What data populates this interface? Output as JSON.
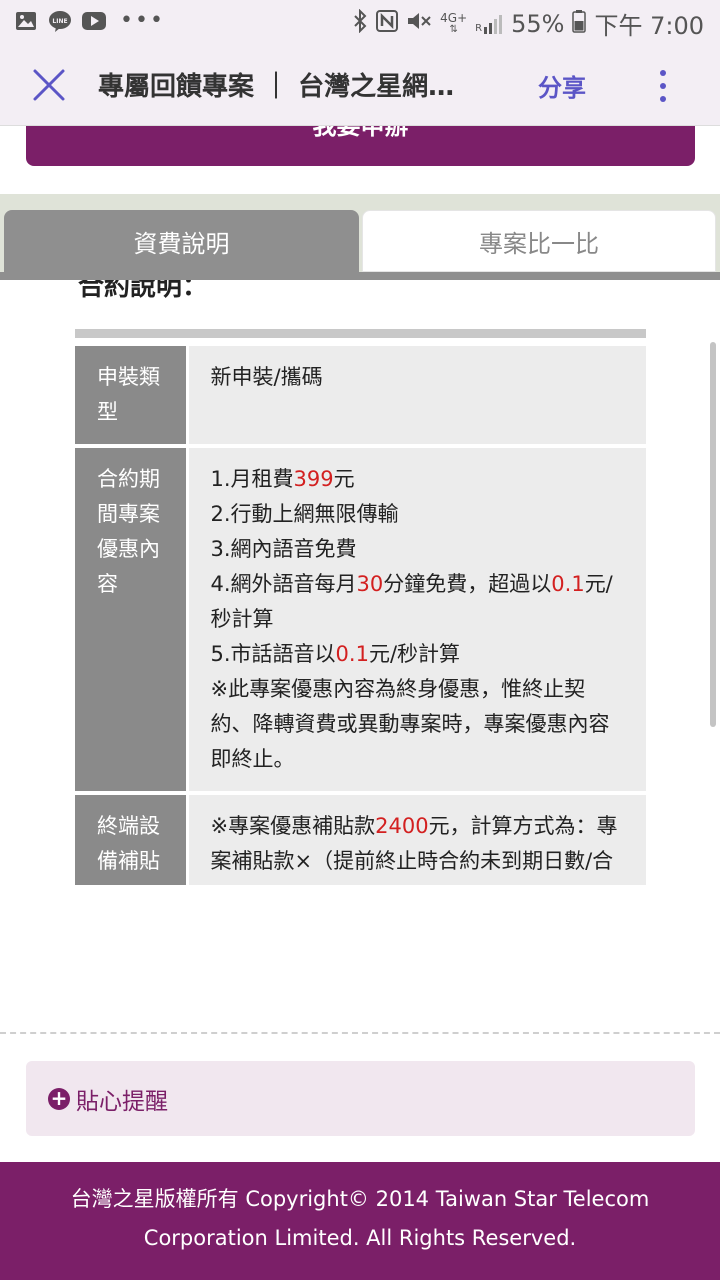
{
  "status_bar": {
    "network": "4G+",
    "signal_label": "R",
    "battery": "55%",
    "time": "下午 7:00",
    "left_icons": [
      "gallery-icon",
      "line-icon",
      "youtube-icon",
      "more-dots-icon"
    ],
    "right_icons": [
      "bluetooth-icon",
      "nfc-icon",
      "mute-icon",
      "signal-icon",
      "battery-icon"
    ]
  },
  "app_bar": {
    "title": "專屬回饋專案 ｜ 台灣之星網…",
    "share_label": "分享"
  },
  "apply_button_label": "我要申辦",
  "tabs": [
    {
      "label": "資費說明",
      "active": true
    },
    {
      "label": "專案比一比",
      "active": false
    }
  ],
  "section_heading": "合約說明：",
  "table": {
    "rows": [
      {
        "label": "申裝類型",
        "lines": [
          [
            {
              "t": "新申裝/攜碼"
            }
          ]
        ]
      },
      {
        "label": "合約期間專案優惠內容",
        "lines": [
          [
            {
              "t": "1.月租費"
            },
            {
              "t": "399",
              "red": true
            },
            {
              "t": "元"
            }
          ],
          [
            {
              "t": "2.行動上網無限傳輸"
            }
          ],
          [
            {
              "t": "3.網內語音免費"
            }
          ],
          [
            {
              "t": "4.網外語音每月"
            },
            {
              "t": "30",
              "red": true
            },
            {
              "t": "分鐘免費，超過以"
            },
            {
              "t": "0.1",
              "red": true
            },
            {
              "t": "元/秒計算"
            }
          ],
          [
            {
              "t": "5.市話語音以"
            },
            {
              "t": "0.1",
              "red": true
            },
            {
              "t": "元/秒計算"
            }
          ],
          [
            {
              "t": "※此專案優惠內容為終身優惠，惟終止契約、降轉資費或異動專案時，專案優惠內容即終止。"
            }
          ]
        ]
      },
      {
        "label": "終端設備補貼及電信",
        "lines": [
          [
            {
              "t": "※專案優惠補貼款"
            },
            {
              "t": "2400",
              "red": true
            },
            {
              "t": "元，計算方式為：專案補貼款×（提前終止時合約未到期日數/合約總日數）（採四捨五入至整數位）。"
            }
          ]
        ]
      }
    ]
  },
  "reminder": {
    "icon": "plus-circle-icon",
    "label": "貼心提醒"
  },
  "footer": {
    "line1": "台灣之星版權所有 Copyright© 2014 Taiwan Star Telecom",
    "line2": "Corporation Limited. All Rights Reserved."
  },
  "colors": {
    "brand": "#7b1f68",
    "accent": "#5b55c6",
    "highlight": "#d32020",
    "tab_active": "#8f8f8f"
  }
}
